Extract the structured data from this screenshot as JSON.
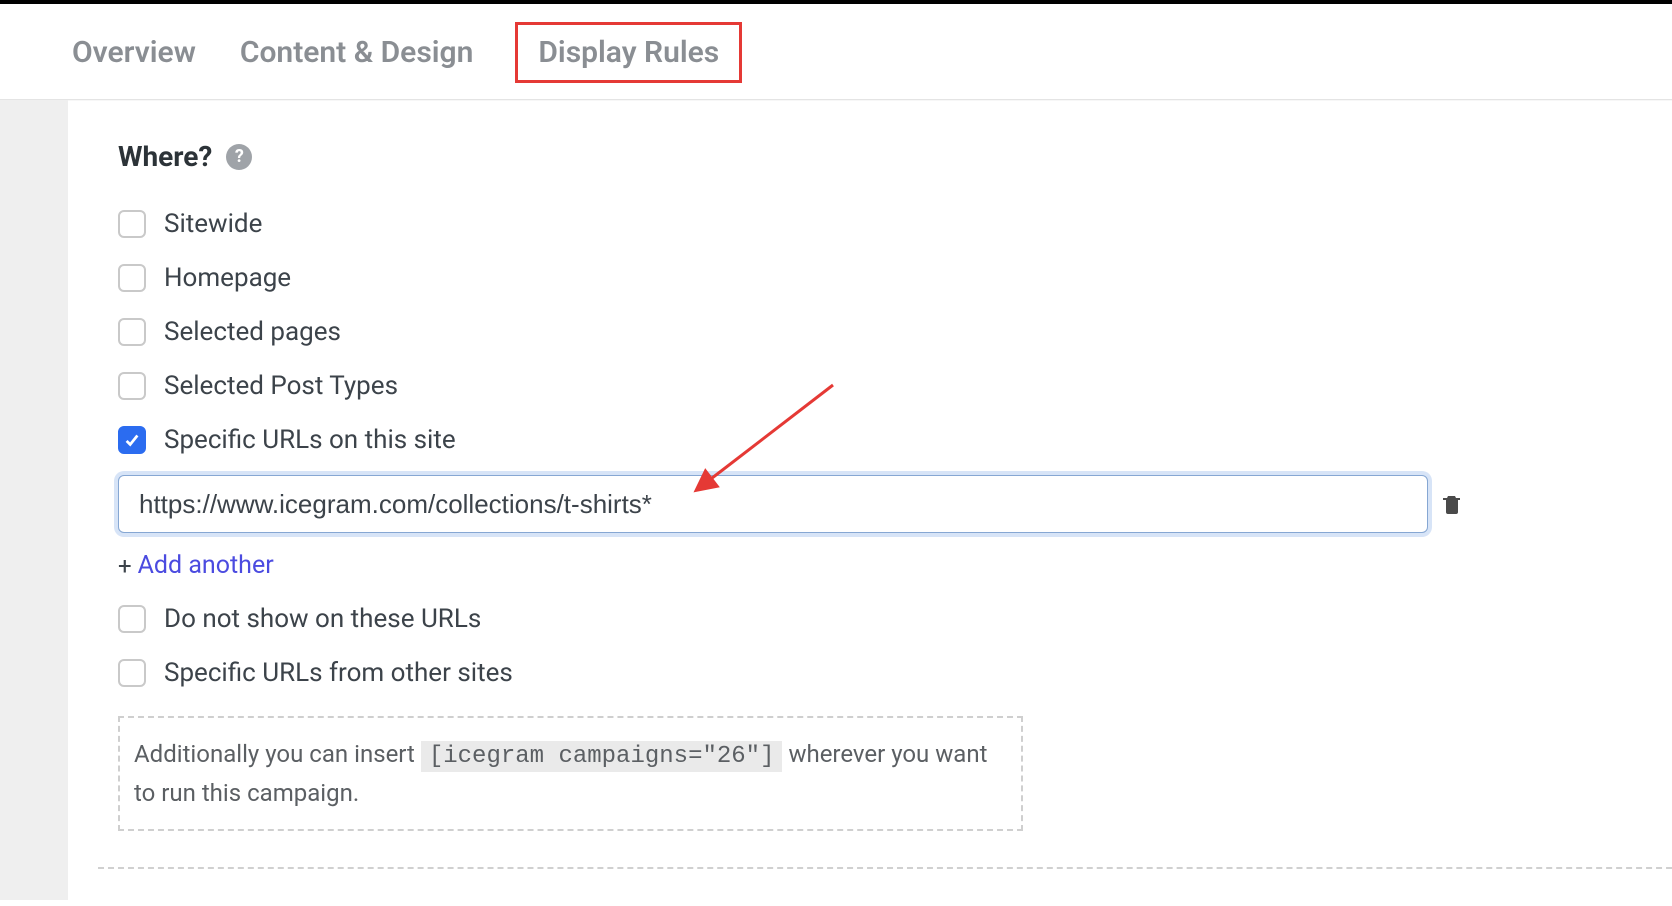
{
  "tabs": {
    "overview": "Overview",
    "content_design": "Content & Design",
    "display_rules": "Display Rules"
  },
  "section": {
    "title": "Where?",
    "help_char": "?"
  },
  "options": {
    "sitewide": {
      "label": "Sitewide",
      "checked": false
    },
    "homepage": {
      "label": "Homepage",
      "checked": false
    },
    "selected_pages": {
      "label": "Selected pages",
      "checked": false
    },
    "selected_post_types": {
      "label": "Selected Post Types",
      "checked": false
    },
    "specific_urls": {
      "label": "Specific URLs on this site",
      "checked": true
    },
    "do_not_show": {
      "label": "Do not show on these URLs",
      "checked": false
    },
    "other_sites": {
      "label": "Specific URLs from other sites",
      "checked": false
    }
  },
  "url_input": {
    "value": "https://www.icegram.com/collections/t-shirts*"
  },
  "add_another": {
    "plus": "+",
    "label": "Add another"
  },
  "shortcode": {
    "prefix": "Additionally you can insert ",
    "code": "[icegram campaigns=\"26\"]",
    "suffix": " wherever you want to run this campaign."
  },
  "icons": {
    "help": "help-icon",
    "trash": "trash-icon",
    "plus": "plus-icon"
  }
}
